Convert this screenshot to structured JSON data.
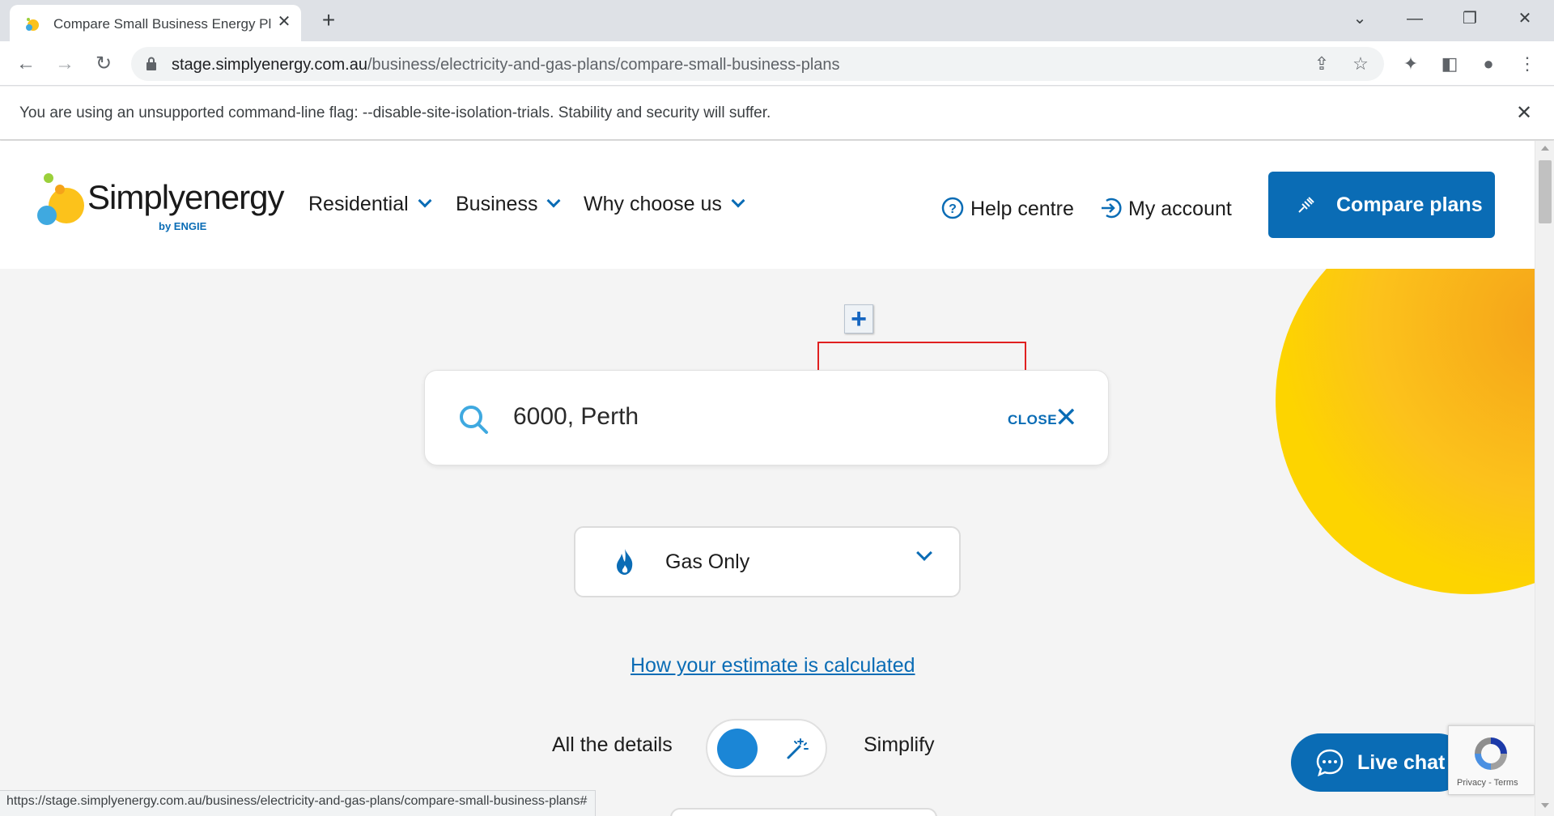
{
  "browser": {
    "tab_title": "Compare Small Business Energy Plans",
    "new_tab_symbol": "+",
    "url_host": "stage.simplyenergy.com.au",
    "url_path": "/business/electricity-and-gas-plans/compare-small-business-plans",
    "infobar_message": "You are using an unsupported command-line flag: --disable-site-isolation-trials. Stability and security will suffer.",
    "status_url": "https://stage.simplyenergy.com.au/business/electricity-and-gas-plans/compare-small-business-plans#"
  },
  "header": {
    "logo_text": "Simplyenergy",
    "logo_by": "by ENGIE",
    "nav": [
      "Residential",
      "Business",
      "Why choose us"
    ],
    "help_label": "Help centre",
    "account_label": "My account",
    "compare_label": "Compare plans"
  },
  "search": {
    "value": "6000, Perth",
    "close_label": "CLOSE"
  },
  "fuel_select": {
    "selected": "Gas Only"
  },
  "estimate_link": "How your estimate is calculated",
  "toggle": {
    "left_label": "All the details",
    "right_label": "Simplify"
  },
  "livechat_label": "Live chat",
  "recaptcha_links": "Privacy - Terms",
  "colors": {
    "brand_blue": "#0a6cb5",
    "sun_yellow": "#fdd400",
    "highlight_red": "#e02020"
  }
}
